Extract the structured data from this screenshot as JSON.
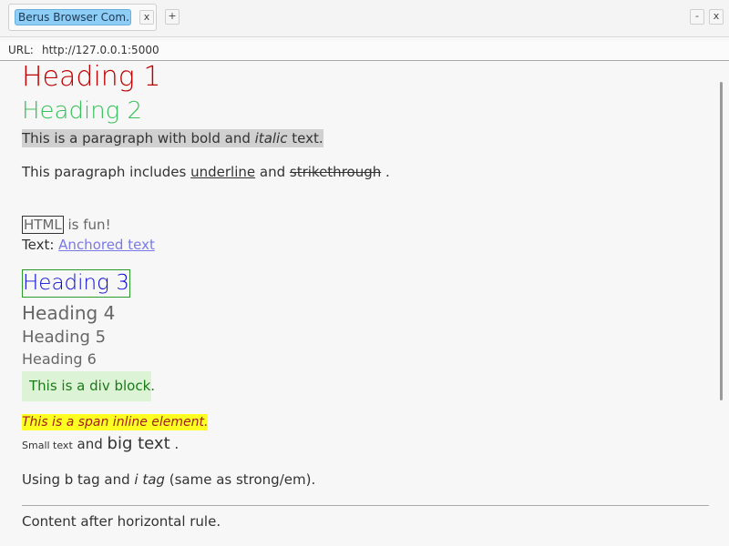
{
  "tab": {
    "title": "Berus Browser Com...",
    "close_label": "x",
    "new_tab_label": "+"
  },
  "window": {
    "minimize_label": "-",
    "close_label": "x"
  },
  "urlbar": {
    "label": "URL:",
    "value": "http://127.0.0.1:5000"
  },
  "content": {
    "heading1": "Heading 1",
    "heading2": "Heading 2",
    "p1": {
      "before": "This is a paragraph with ",
      "bold": "bold",
      "middle": " and ",
      "italic": "italic",
      "after": " text."
    },
    "p2": {
      "before": "This paragraph includes ",
      "underline": "underline",
      "middle": " and ",
      "strike": "strikethrough",
      "after": " ."
    },
    "fun": {
      "boxed": "HTML",
      "rest": " is fun!"
    },
    "anchor_line": {
      "label": "Text: ",
      "link": "Anchored text"
    },
    "heading3": "Heading 3",
    "heading4": "Heading 4",
    "heading5": "Heading 5",
    "heading6": "Heading 6",
    "div_block": "This is a div block.",
    "span_inline": "This is a span inline element.",
    "sizes": {
      "small": "Small text",
      "middle": " and ",
      "big": "big text",
      "after": " ."
    },
    "btag": {
      "before": "Using ",
      "b": "b tag",
      "middle": " and ",
      "i": "i tag",
      "after": " (same as strong/em)."
    },
    "after_hr": "Content after horizontal rule."
  },
  "colors": {
    "heading1": "#c00000",
    "heading2": "#38c05a",
    "heading3": "#0a0ad6",
    "link": "#7a7ae6",
    "highlight": "#ffff22"
  }
}
